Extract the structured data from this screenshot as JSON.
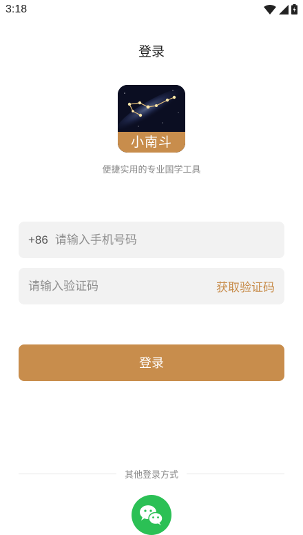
{
  "status_bar": {
    "time": "3:18",
    "icons": [
      "wifi-icon",
      "signal-icon",
      "battery-icon"
    ]
  },
  "page": {
    "title": "登录"
  },
  "logo": {
    "label": "小南斗",
    "icon": "constellation-icon"
  },
  "tagline": "便捷实用的专业国学工具",
  "phone_input": {
    "country_code": "+86",
    "placeholder": "请输入手机号码",
    "value": ""
  },
  "code_input": {
    "placeholder": "请输入验证码",
    "value": "",
    "get_code_label": "获取验证码"
  },
  "login_button": {
    "label": "登录"
  },
  "other_login": {
    "label": "其他登录方式",
    "methods": [
      "wechat-icon"
    ]
  },
  "colors": {
    "accent": "#c88d4c",
    "wechat": "#2bc055",
    "input_bg": "#f2f2f2"
  }
}
